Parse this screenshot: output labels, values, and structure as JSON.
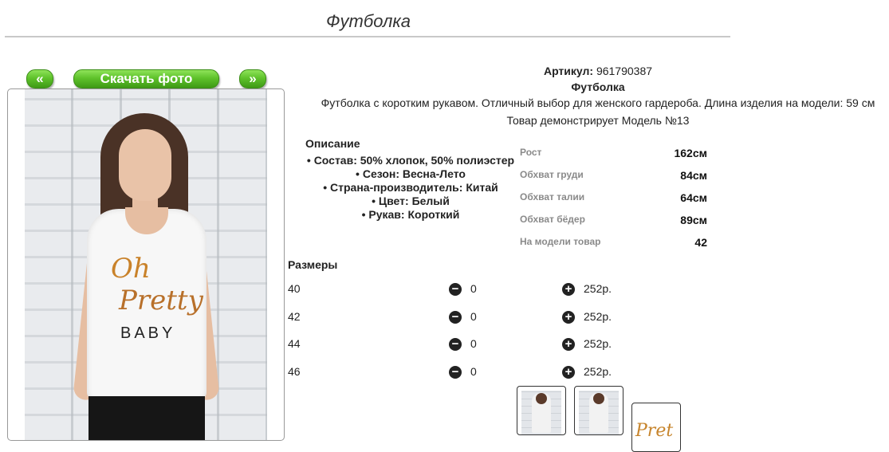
{
  "page_title": "Футболка",
  "nav": {
    "prev_label": "«",
    "download_label": "Скачать фото",
    "next_label": "»"
  },
  "photo": {
    "print_line1": "Oh",
    "print_line2": "Pretty",
    "print_line3": "BABY"
  },
  "product": {
    "sku_label": "Артикул:",
    "sku_value": " 961790387",
    "name": "Футболка",
    "description": "Футболка с коротким рукавом. Отличный выбор для женского гардероба. Длина изделия на модели: 59 см",
    "model_line": "Товар демонстрирует Модель №13"
  },
  "description_block": {
    "heading": "Описание",
    "items": [
      "Состав: 50% хлопок, 50% полиэстер",
      "Сезон: Весна-Лето",
      "Страна-производитель: Китай",
      "Цвет: Белый",
      "Рукав: Короткий"
    ]
  },
  "model_params": [
    {
      "label": "Рост",
      "value": "162см"
    },
    {
      "label": "Обхват груди",
      "value": "84см"
    },
    {
      "label": "Обхват талии",
      "value": "64см"
    },
    {
      "label": "Обхват бёдер",
      "value": "89см"
    },
    {
      "label": "На модели товар",
      "value": "42"
    }
  ],
  "sizes": {
    "heading": "Размеры",
    "rows": [
      {
        "size": "40",
        "qty": "0",
        "price": "252р."
      },
      {
        "size": "42",
        "qty": "0",
        "price": "252р."
      },
      {
        "size": "44",
        "qty": "0",
        "price": "252р."
      },
      {
        "size": "46",
        "qty": "0",
        "price": "252р."
      }
    ]
  },
  "thumbnails": {
    "thumb3_print": "Pret"
  }
}
